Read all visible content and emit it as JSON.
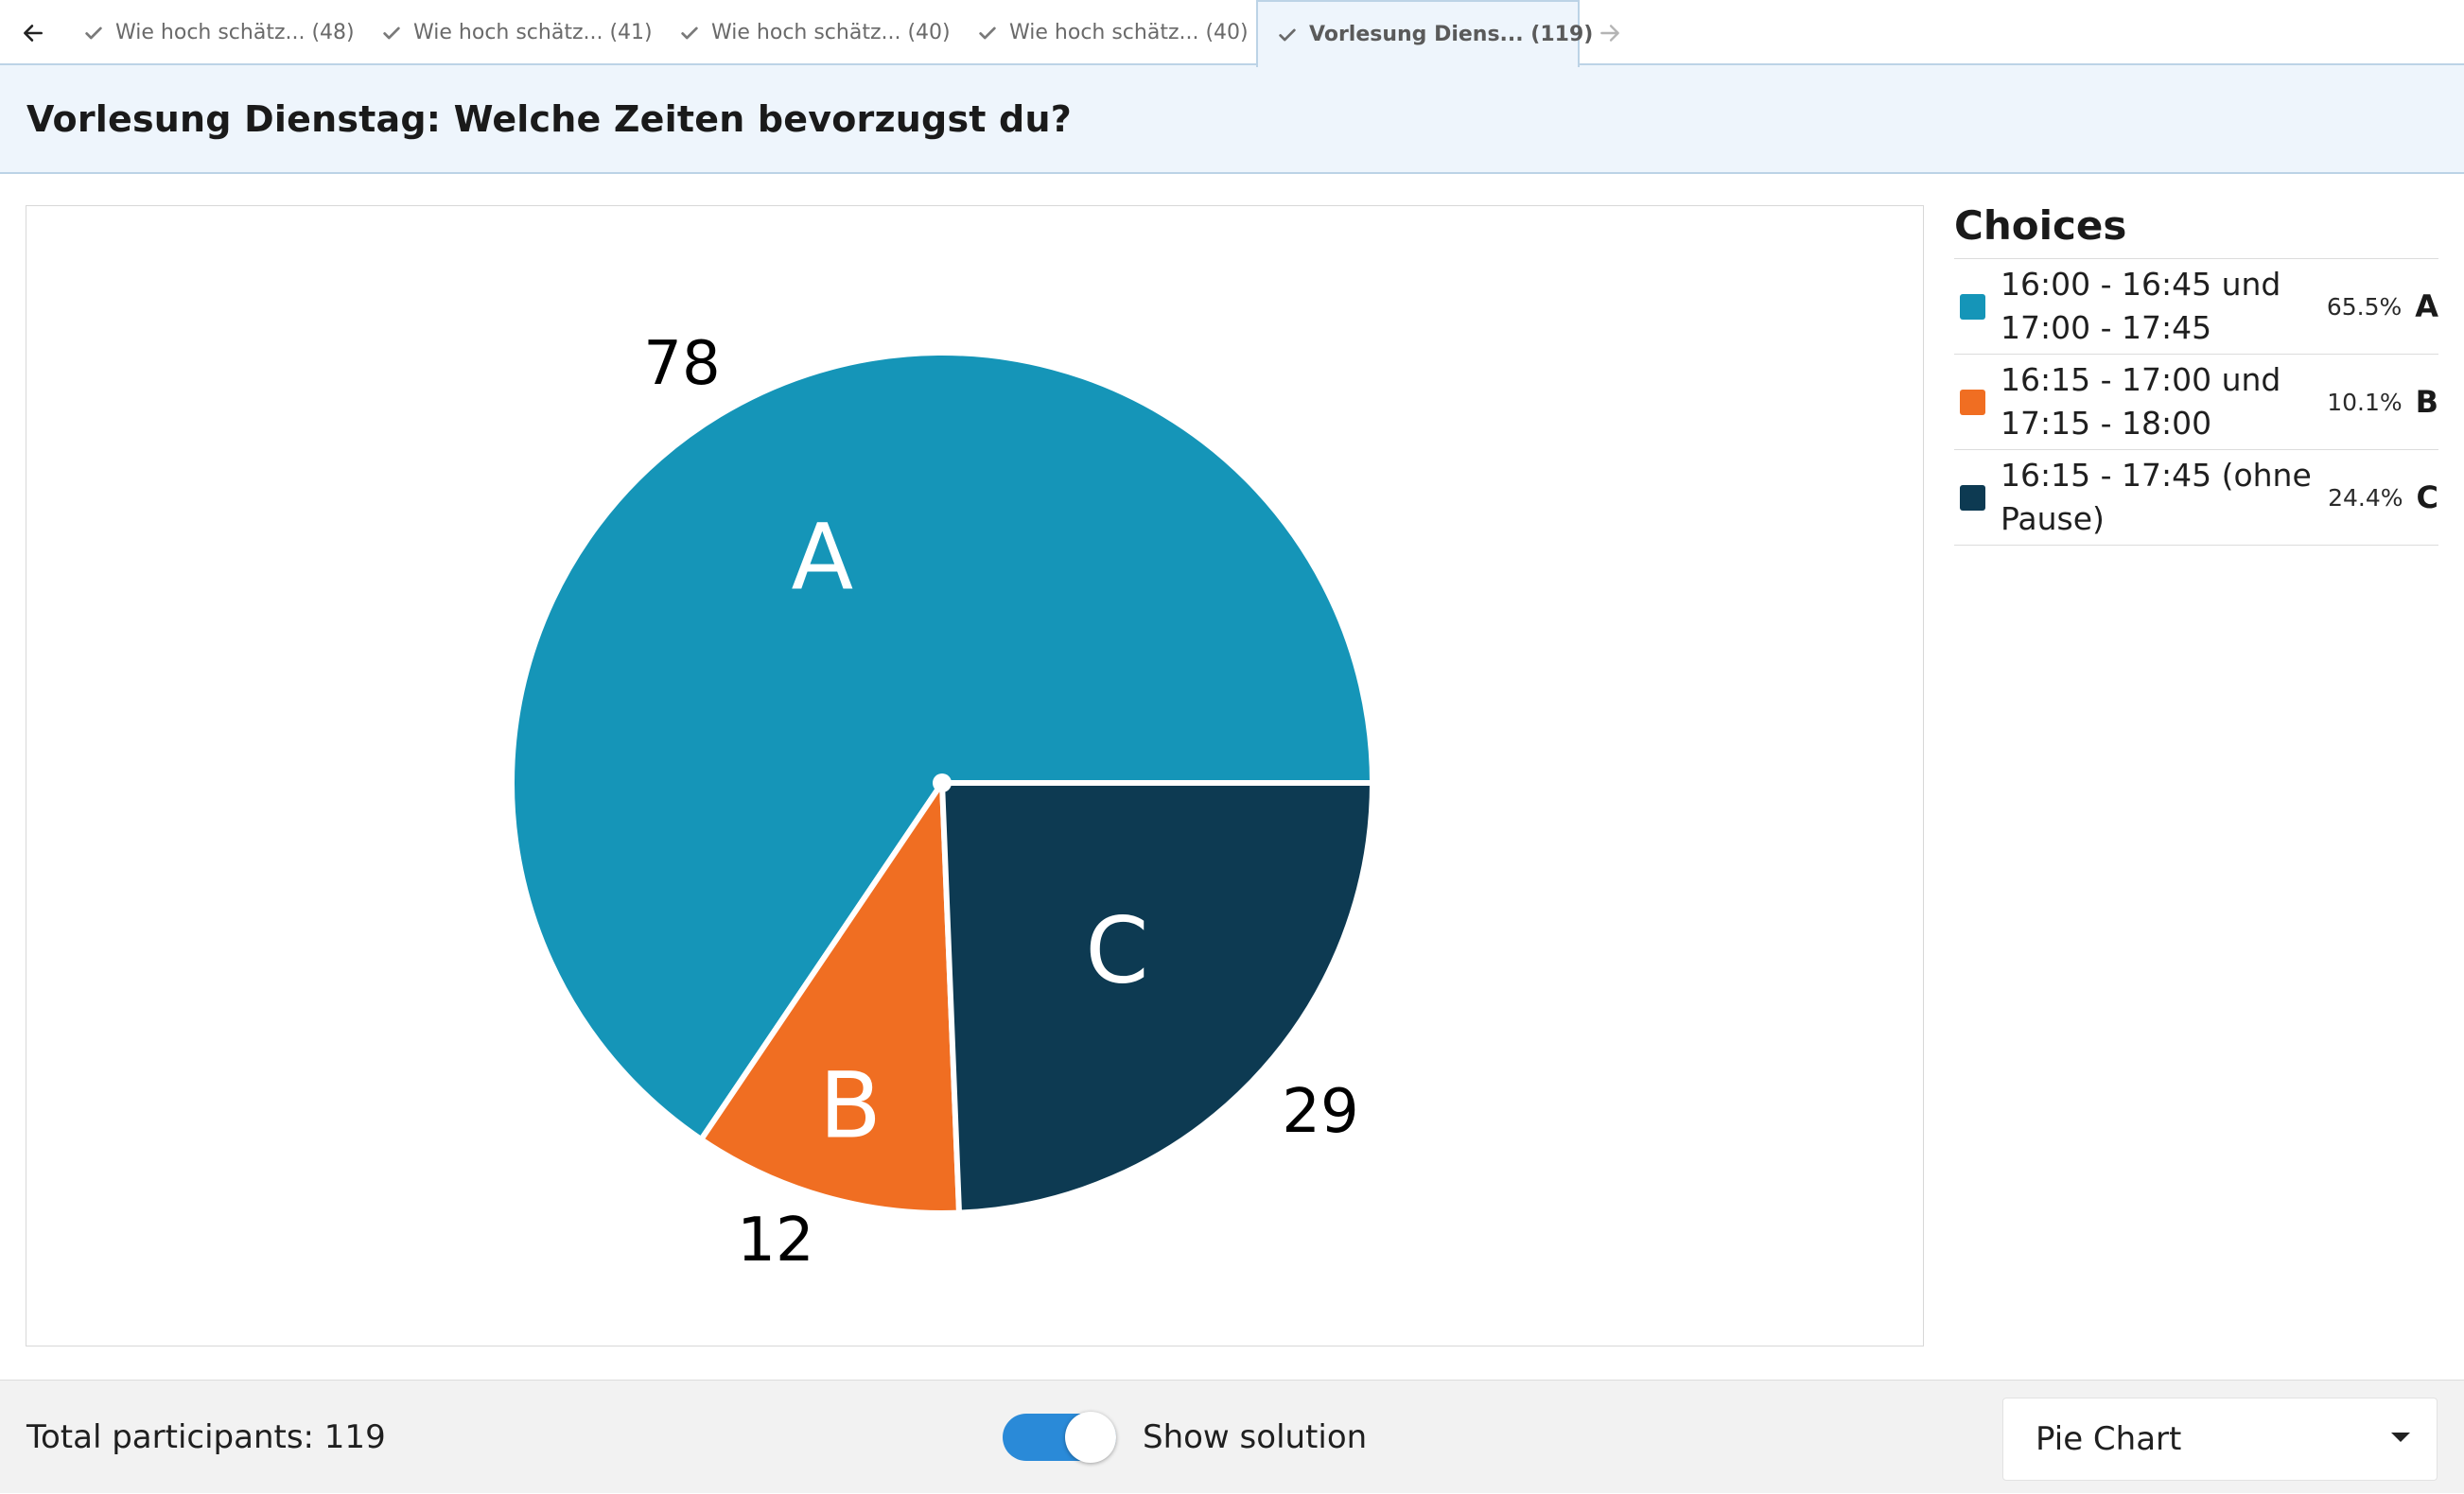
{
  "tabs": [
    {
      "label": "Wie hoch schätz... (48)",
      "active": false
    },
    {
      "label": "Wie hoch schätz... (41)",
      "active": false
    },
    {
      "label": "Wie hoch schätz... (40)",
      "active": false
    },
    {
      "label": "Wie hoch schätz... (40)",
      "active": false
    },
    {
      "label": "Vorlesung Diens... (119)",
      "active": true
    }
  ],
  "title": "Vorlesung Dienstag: Welche Zeiten bevorzugst du?",
  "legend": {
    "heading": "Choices",
    "choices": [
      {
        "text": "16:00 - 16:45 und 17:00 - 17:45",
        "percent": "65.5%",
        "letter": "A",
        "color": "#1595b8"
      },
      {
        "text": "16:15 - 17:00 und 17:15 - 18:00",
        "percent": "10.1%",
        "letter": "B",
        "color": "#f06e22"
      },
      {
        "text": "16:15 - 17:45 (ohne Pause)",
        "percent": "24.4%",
        "letter": "C",
        "color": "#0d3a52"
      }
    ]
  },
  "chart_data": {
    "type": "pie",
    "categories": [
      "A",
      "B",
      "C"
    ],
    "values": [
      78,
      12,
      29
    ],
    "colors": [
      "#1595b8",
      "#f06e22",
      "#0d3a52"
    ]
  },
  "footer": {
    "total_label": "Total participants: 119",
    "show_solution_label": "Show solution",
    "show_solution_on": true,
    "chart_type_selected": "Pie Chart"
  }
}
